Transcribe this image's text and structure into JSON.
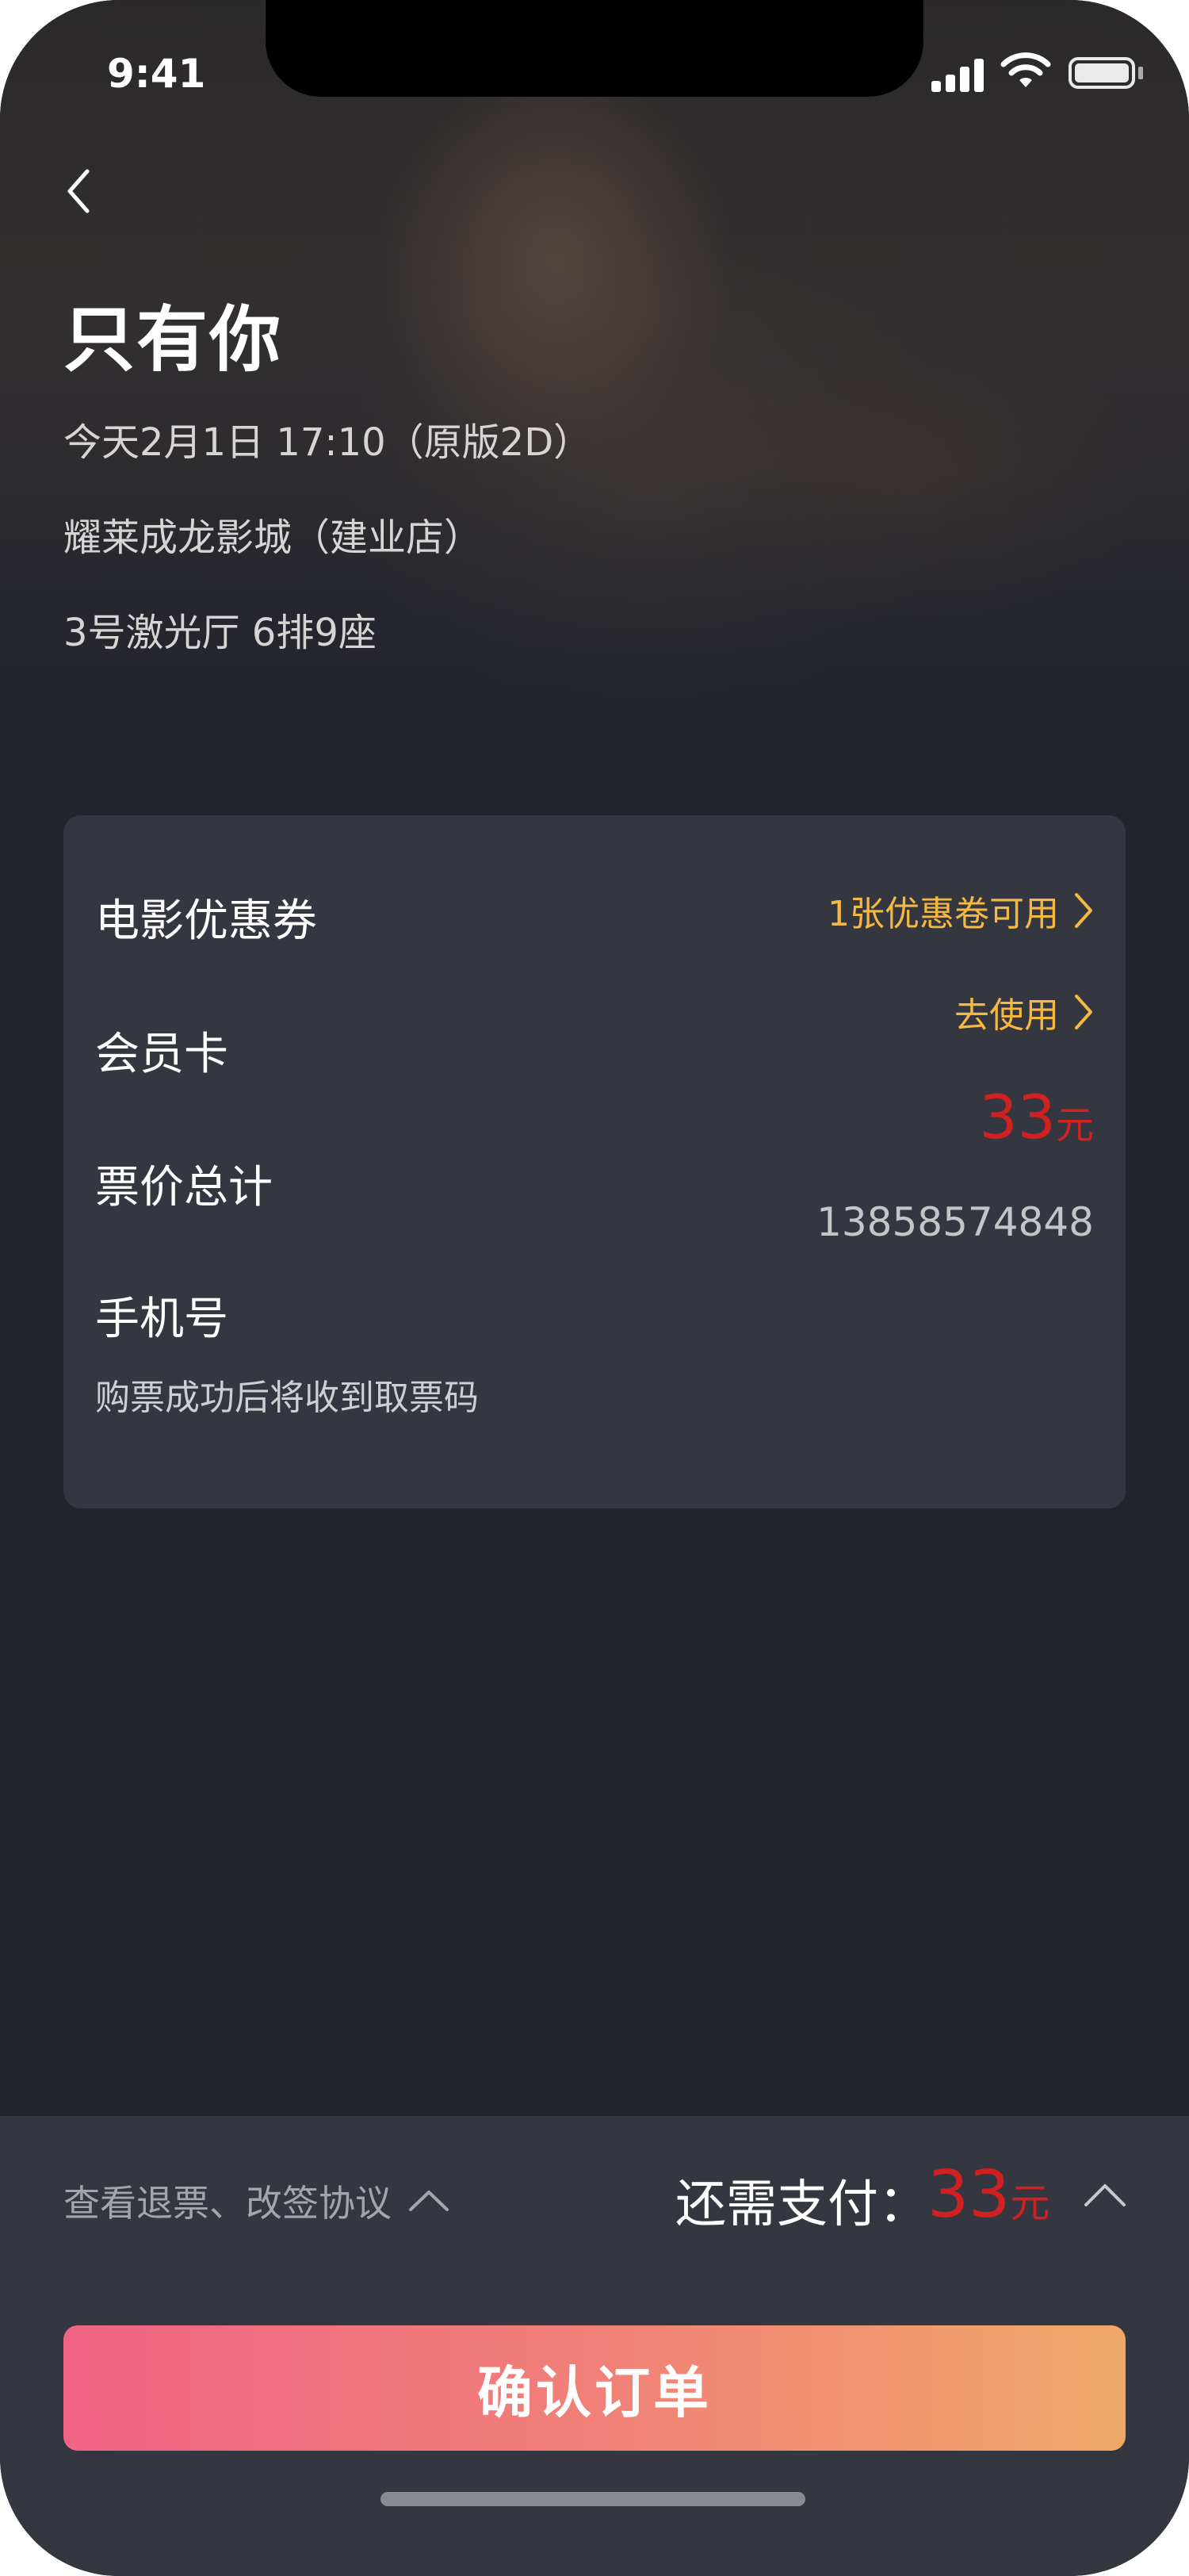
{
  "status_bar": {
    "time": "9:41"
  },
  "header": {
    "movie_title": "只有你",
    "showtime": "今天2月1日 17:10（原版2D）",
    "cinema": "耀莱成龙影城（建业店）",
    "seat": "3号激光厅 6排9座"
  },
  "order_card": {
    "coupon_label": "电影优惠券",
    "coupon_value": "1张优惠卷可用",
    "member_label": "会员卡",
    "member_value": "去使用",
    "total_label": "票价总计",
    "total_amount": "33",
    "total_unit": "元",
    "phone_label": "手机号",
    "phone_number": "13858574848",
    "phone_note": "购票成功后将收到取票码"
  },
  "footer": {
    "policy_link": "查看退票、改签协议",
    "pay_label": "还需支付：",
    "pay_amount": "33",
    "pay_unit": "元",
    "confirm_label": "确认订单"
  },
  "colors": {
    "accent_yellow": "#f5b942",
    "price_red": "#d02020",
    "button_gradient_start": "#f06585",
    "button_gradient_end": "#f0a868"
  }
}
